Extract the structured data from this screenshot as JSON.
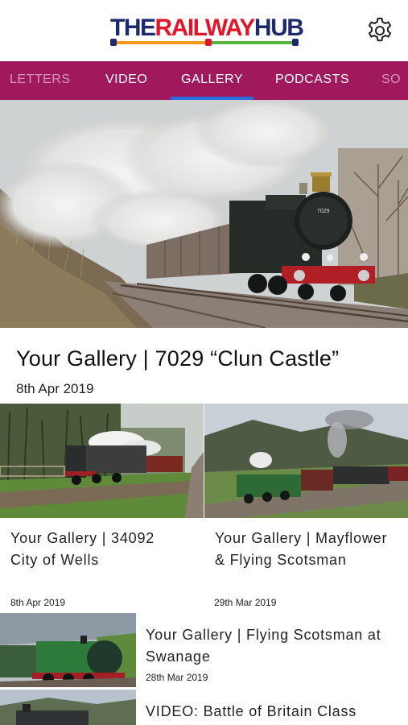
{
  "header": {
    "logo": {
      "the": "THE",
      "railway": "RAILWAY",
      "hub": "HUB"
    },
    "settings_icon": "gear-icon"
  },
  "nav": {
    "tabs": [
      {
        "label": "LETTERS",
        "state": "partial-left"
      },
      {
        "label": "VIDEO"
      },
      {
        "label": "GALLERY",
        "active": true
      },
      {
        "label": "PODCASTS"
      },
      {
        "label": "SO",
        "state": "partial-right"
      }
    ],
    "colors": {
      "background": "#a0185e",
      "active_indicator": "#2a6edb"
    }
  },
  "featured": {
    "title": "Your Gallery | 7029 “Clun Castle”",
    "date": "8th Apr 2019"
  },
  "cards": [
    {
      "title_line1": "Your Gallery | 34092",
      "title_line2": "City of Wells",
      "date": "8th Apr 2019"
    },
    {
      "title_line1": "Your Gallery | Mayflower",
      "title_line2": "& Flying Scotsman",
      "date": "29th Mar 2019"
    }
  ],
  "list": [
    {
      "title_line1": "Your Gallery | Flying Scotsman at",
      "title_line2": "Swanage",
      "date": "28th Mar 2019"
    },
    {
      "title_line1": "VIDEO: Battle of Britain Class",
      "title_line2": "",
      "date": ""
    }
  ]
}
